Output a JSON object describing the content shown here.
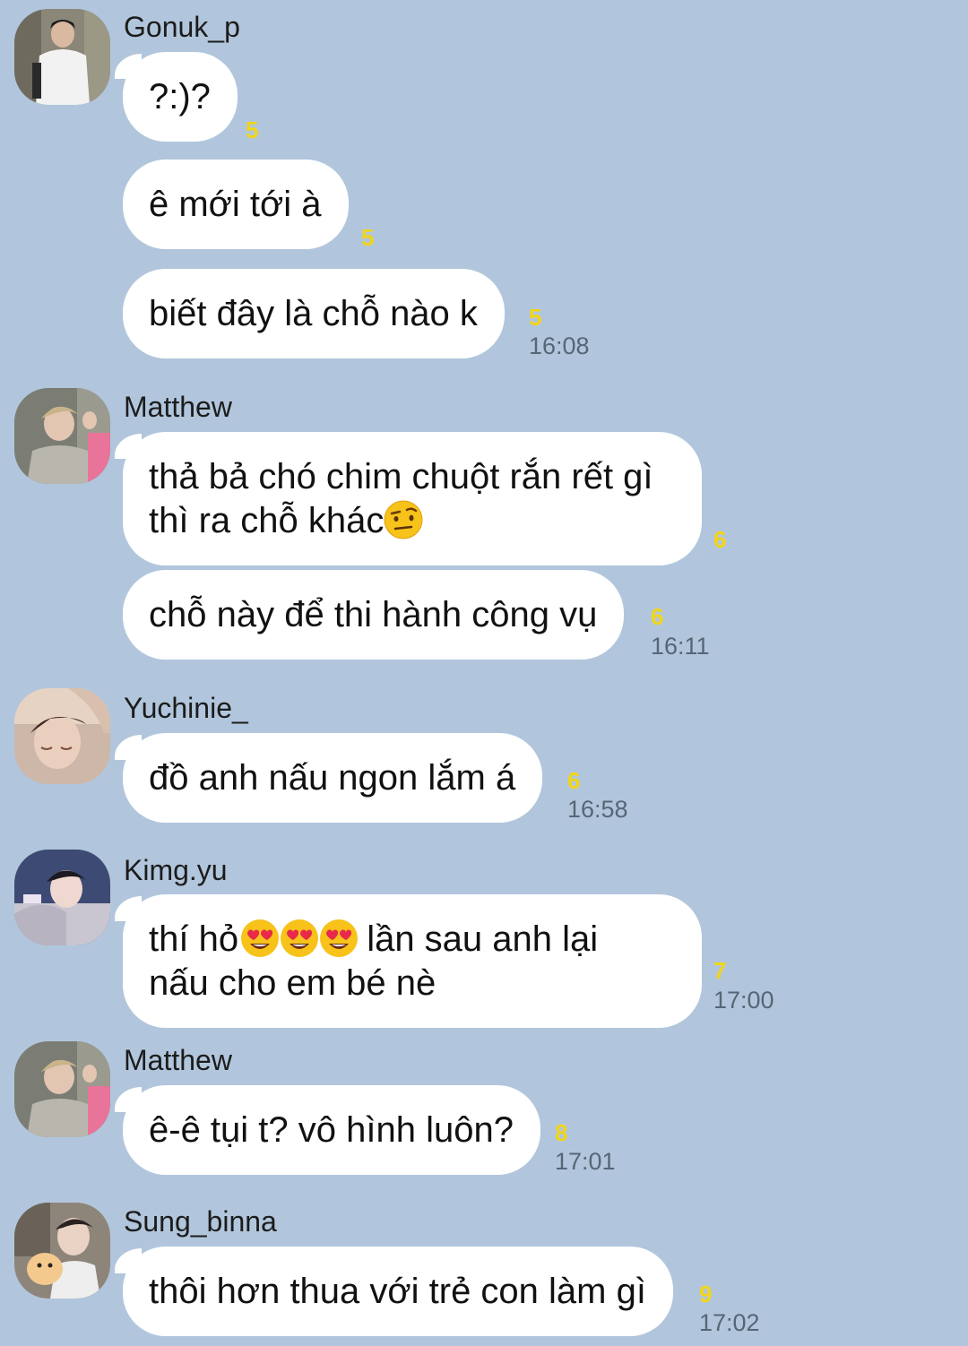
{
  "colors": {
    "background": "#b1c6dc",
    "bubble": "#ffffff",
    "read_count": "#f2d518",
    "timestamp": "#566676"
  },
  "messages": [
    {
      "sender": "Gonuk_p",
      "avatar_icon": "profile-photo-icon",
      "bubbles": [
        {
          "text": "?:)?",
          "read": "5"
        },
        {
          "text": "ê mới tới à",
          "read": "5"
        },
        {
          "text": "biết đây là chỗ nào k",
          "read": "5",
          "time": "16:08"
        }
      ]
    },
    {
      "sender": "Matthew",
      "avatar_icon": "profile-photo-icon",
      "bubbles": [
        {
          "line1": "thả bả chó chim chuột rắn rết gì",
          "line2": "thì ra chỗ khác",
          "emoji": "raised-eyebrow-emoji-icon",
          "read": "6"
        },
        {
          "text": "chỗ này để thi hành công vụ",
          "read": "6",
          "time": "16:11"
        }
      ]
    },
    {
      "sender": "Yuchinie_",
      "avatar_icon": "profile-photo-icon",
      "bubbles": [
        {
          "text": "đồ anh nấu ngon lắm á",
          "read": "6",
          "time": "16:58"
        }
      ]
    },
    {
      "sender": "Kimg.yu",
      "avatar_icon": "profile-photo-icon",
      "bubbles": [
        {
          "line1_a": "thí hỏ",
          "line1_b": " lần sau anh lại",
          "line2": "nấu cho em bé nè",
          "emoji": "heart-eyes-emoji-icon",
          "read": "7",
          "time": "17:00"
        }
      ]
    },
    {
      "sender": "Matthew",
      "avatar_icon": "profile-photo-icon",
      "bubbles": [
        {
          "text": "ê-ê tụi t? vô hình luôn?",
          "read": "8",
          "time": "17:01"
        }
      ]
    },
    {
      "sender": "Sung_binna",
      "avatar_icon": "profile-photo-icon",
      "bubbles": [
        {
          "text": "thôi hơn thua với trẻ con làm gì",
          "read": "9",
          "time": "17:02"
        }
      ]
    }
  ]
}
